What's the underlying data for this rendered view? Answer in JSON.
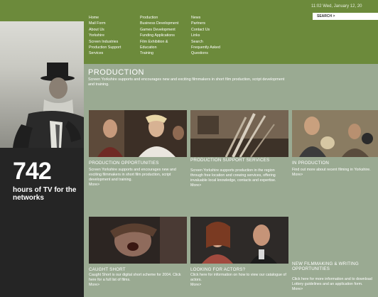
{
  "header": {
    "date": "11:02 Wed, January 12, 20",
    "search_label": "SEARCH >",
    "nav_col1": [
      "Home",
      "Mail Form",
      "About Us",
      "Yorkshire",
      "Screen Industries",
      "Production Support Services"
    ],
    "nav_col2": [
      "Production",
      "Business Development",
      "Games Development",
      "Funding Applications",
      "Film Exhibition & Education",
      "Training"
    ],
    "nav_col3": [
      "News",
      "Partners",
      "Contact Us",
      "Links",
      "Search",
      "Frequently Asked Questions"
    ]
  },
  "left": {
    "stat_number": "742",
    "stat_caption": "hours of TV for the networks"
  },
  "section": {
    "title": "PRODUCTION",
    "description": "Screen Yorkshire supports and encourages new and exciting filmmakers in short film production, script development and training."
  },
  "cards": [
    {
      "title": "PRODUCTION OPPORTUNITIES",
      "text": "Screen Yorkshire supports and encourages new and exciting filmmakers in short film production, script development and training.",
      "more": "More>"
    },
    {
      "title": "PRODUCTION SUPPORT SERVICES",
      "text": "Screen Yorkshire supports production in the region through free location and crewing services, offering invaluable local knowledge, contacts and expertise.",
      "more": "More>"
    },
    {
      "title": "IN PRODUCTION",
      "text": "Find out more about recent filming in Yorkshire.",
      "more": "More>"
    },
    {
      "title": "CAUGHT SHORT",
      "text": "Caught Short is our digital short scheme for 2004. Click here for a full list of films.",
      "more": "More>"
    },
    {
      "title": "LOOKING FOR ACTORS?",
      "text": "Click here for information on how to view our catalogue of actors.",
      "more": "More>"
    },
    {
      "title": "NEW FILMMAKING & WRITING OPPORTUNITIES",
      "text": "Click here for more information and to download Lottery guidelines and an application form.",
      "more": "More>"
    }
  ],
  "colors": {
    "header_green": "#6c8a3b",
    "page_green": "#9aaa92",
    "left_dark": "#252525"
  }
}
